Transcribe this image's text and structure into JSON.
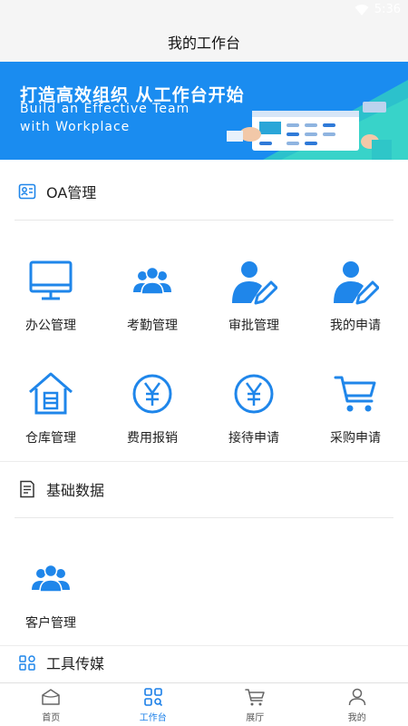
{
  "status_bar": {
    "time": "5:36"
  },
  "header": {
    "title": "我的工作台"
  },
  "banner": {
    "headline": "打造高效组织 从工作台开始",
    "subline1": "Build an Effective Team",
    "subline2": "with Workplace"
  },
  "sections": {
    "oa": {
      "title": "OA管理",
      "items": [
        {
          "label": "办公管理",
          "icon": "monitor-icon"
        },
        {
          "label": "考勤管理",
          "icon": "group-icon"
        },
        {
          "label": "审批管理",
          "icon": "user-edit-icon"
        },
        {
          "label": "我的申请",
          "icon": "user-edit-icon"
        },
        {
          "label": "仓库管理",
          "icon": "warehouse-icon"
        },
        {
          "label": "费用报销",
          "icon": "yen-circle-icon"
        },
        {
          "label": "接待申请",
          "icon": "yen-circle-icon"
        },
        {
          "label": "采购申请",
          "icon": "cart-icon"
        }
      ]
    },
    "basic": {
      "title": "基础数据",
      "items": [
        {
          "label": "客户管理",
          "icon": "group-icon"
        }
      ]
    },
    "tools": {
      "title": "工具传媒"
    }
  },
  "tabbar": {
    "items": [
      {
        "label": "首页",
        "icon": "home-icon"
      },
      {
        "label": "工作台",
        "icon": "workbench-icon",
        "active": true
      },
      {
        "label": "展厅",
        "icon": "cart-icon"
      },
      {
        "label": "我的",
        "icon": "person-icon"
      }
    ]
  },
  "colors": {
    "accent": "#1a7fe8",
    "banner": "#1a8cf0",
    "icon_blue": "#1f86ea"
  }
}
